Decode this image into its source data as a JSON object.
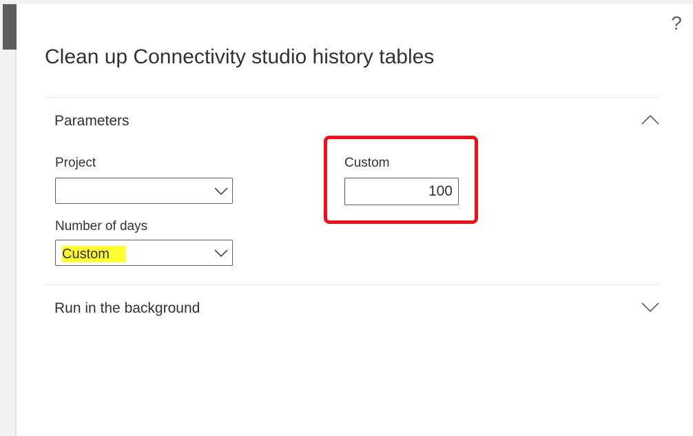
{
  "dialog": {
    "title": "Clean up Connectivity studio history tables",
    "help_label": "?"
  },
  "parameters": {
    "section_title": "Parameters",
    "project": {
      "label": "Project",
      "value": ""
    },
    "number_of_days": {
      "label": "Number of days",
      "value": "Custom"
    },
    "custom": {
      "label": "Custom",
      "value": "100"
    }
  },
  "run_in_background": {
    "section_title": "Run in the background"
  },
  "icons": {
    "help": "question-mark-icon",
    "expanded": "chevron-up-icon",
    "collapsed": "chevron-down-icon",
    "dropdown": "chevron-down-icon"
  },
  "colors": {
    "annotation_box": "#e8111c",
    "value_highlight": "#ffff33"
  }
}
